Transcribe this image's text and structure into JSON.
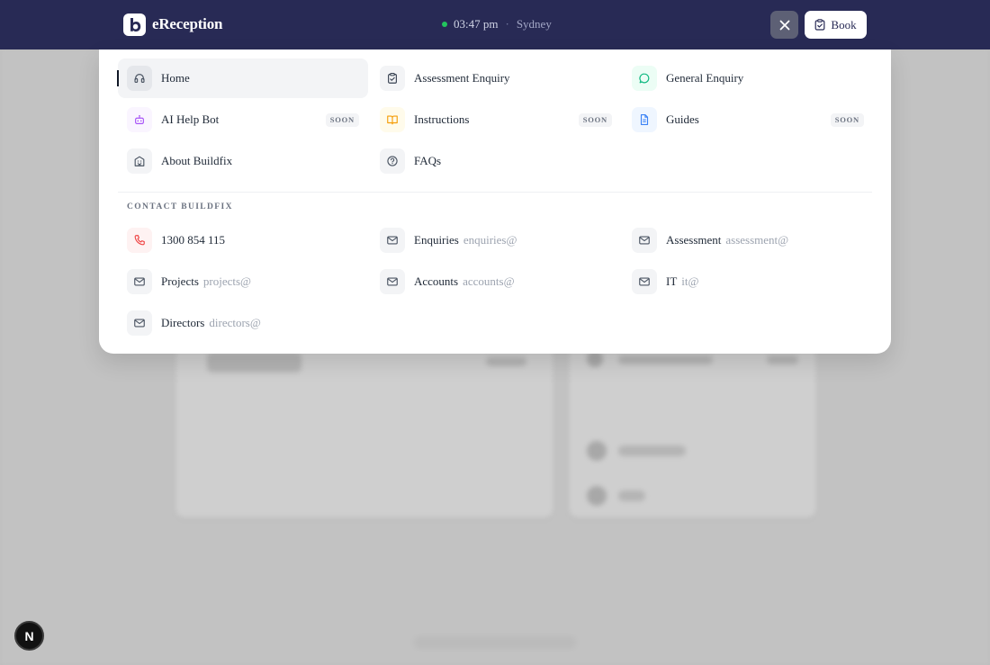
{
  "header": {
    "brand": "eReception",
    "logo_letter": "b",
    "time": "03:47 pm",
    "separator": "·",
    "city": "Sydney",
    "book_label": "Book"
  },
  "menu": {
    "items": [
      {
        "label": "Home",
        "icon": "headset-icon",
        "color": "#4b5563",
        "bg": "#e5e7eb",
        "active": true
      },
      {
        "label": "Assessment Enquiry",
        "icon": "clipboard-check-icon",
        "color": "#374151",
        "bg": "#f3f4f6"
      },
      {
        "label": "General Enquiry",
        "icon": "chat-bubble-icon",
        "color": "#10b981",
        "bg": "#ecfdf5"
      },
      {
        "label": "AI Help Bot",
        "icon": "bot-icon",
        "color": "#a855f7",
        "bg": "#faf5ff",
        "badge": "SOON"
      },
      {
        "label": "Instructions",
        "icon": "open-book-icon",
        "color": "#f59e0b",
        "bg": "#fffbeb",
        "badge": "SOON"
      },
      {
        "label": "Guides",
        "icon": "document-icon",
        "color": "#3b82f6",
        "bg": "#eff6ff",
        "badge": "SOON"
      },
      {
        "label": "About Buildfix",
        "icon": "building-icon",
        "color": "#4b5563",
        "bg": "#f3f4f6"
      },
      {
        "label": "FAQs",
        "icon": "help-circle-icon",
        "color": "#4b5563",
        "bg": "#f3f4f6"
      }
    ]
  },
  "contact": {
    "title": "CONTACT BUILDFIX",
    "items": [
      {
        "label": "1300 854 115",
        "sub": "",
        "icon": "phone-icon",
        "color": "#ef4444",
        "bg": "#fef2f2"
      },
      {
        "label": "Enquiries",
        "sub": "enquiries@",
        "icon": "mail-icon",
        "color": "#4b5563",
        "bg": "#f3f4f6"
      },
      {
        "label": "Assessment",
        "sub": "assessment@",
        "icon": "mail-icon",
        "color": "#4b5563",
        "bg": "#f3f4f6"
      },
      {
        "label": "Projects",
        "sub": "projects@",
        "icon": "mail-icon",
        "color": "#4b5563",
        "bg": "#f3f4f6"
      },
      {
        "label": "Accounts",
        "sub": "accounts@",
        "icon": "mail-icon",
        "color": "#4b5563",
        "bg": "#f3f4f6"
      },
      {
        "label": "IT",
        "sub": "it@",
        "icon": "mail-icon",
        "color": "#4b5563",
        "bg": "#f3f4f6"
      },
      {
        "label": "Directors",
        "sub": "directors@",
        "icon": "mail-icon",
        "color": "#4b5563",
        "bg": "#f3f4f6"
      }
    ]
  },
  "devtools": {
    "label": "N"
  }
}
